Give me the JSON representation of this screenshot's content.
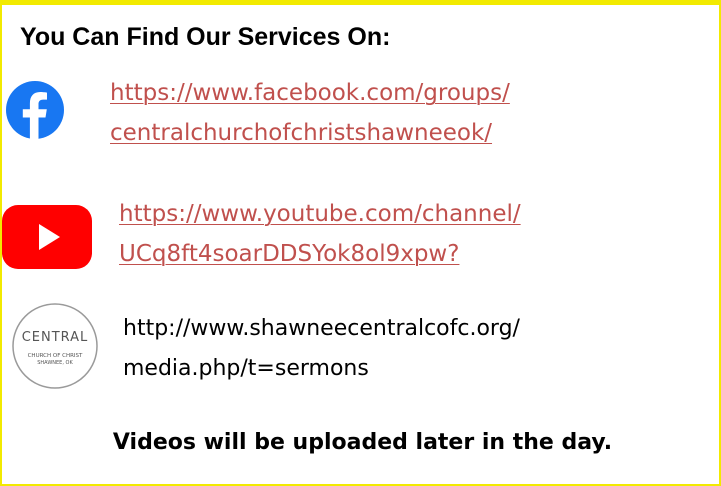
{
  "heading": "You Can Find Our Services On:",
  "colors": {
    "frame": "#f2ea00",
    "link": "#c0504d",
    "facebook": "#1877f2",
    "youtube": "#ff0000"
  },
  "services": [
    {
      "icon": "facebook-icon",
      "line1": "https://www.facebook.com/groups/",
      "line2": "centralchurchofchristshawneeok/"
    },
    {
      "icon": "youtube-icon",
      "line1": "https://www.youtube.com/channel/",
      "line2": "UCq8ft4soarDDSYok8ol9xpw?"
    },
    {
      "icon": "central-church-logo",
      "line1": "http://www.shawneecentralcofc.org/",
      "line2": "media.php/t=sermons",
      "logo_text": {
        "main": "CENTRAL",
        "sub1": "CHURCH OF CHRIST",
        "sub2": "SHAWNEE, OK"
      }
    }
  ],
  "footer": "Videos will be uploaded later in the day."
}
